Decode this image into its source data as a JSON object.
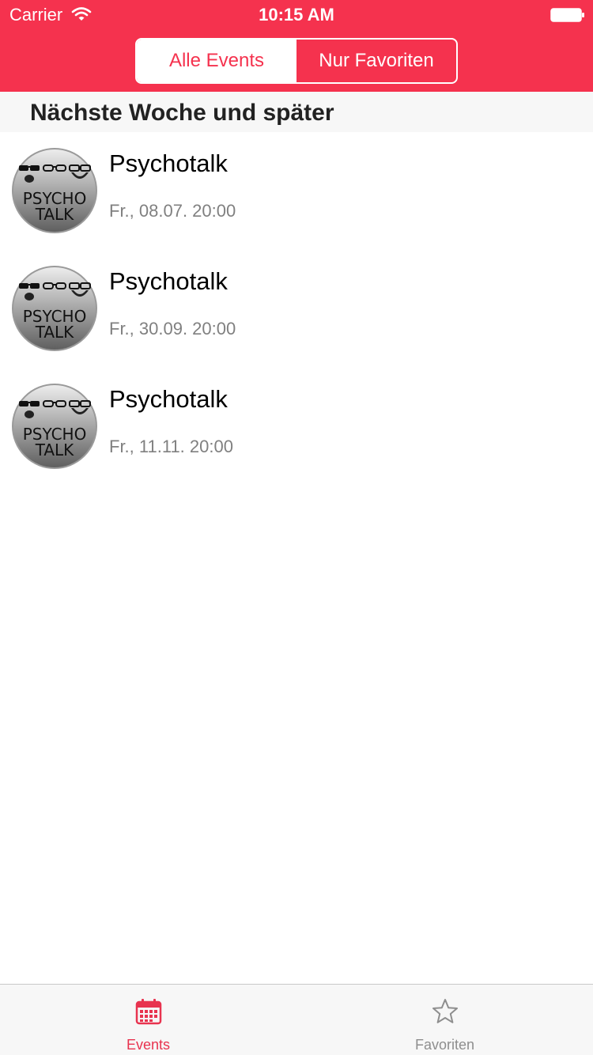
{
  "status_bar": {
    "carrier": "Carrier",
    "time": "10:15 AM",
    "wifi_icon": "wifi-icon",
    "battery_icon": "battery-icon"
  },
  "segmented_control": {
    "options": [
      "Alle Events",
      "Nur Favoriten"
    ],
    "selected": "Alle Events"
  },
  "section": {
    "title": "Nächste Woche und später"
  },
  "events": [
    {
      "title": "Psychotalk",
      "date": "Fr., 08.07. 20:00",
      "logo_text": [
        "PSYCHO",
        "TALK"
      ]
    },
    {
      "title": "Psychotalk",
      "date": "Fr., 30.09. 20:00",
      "logo_text": [
        "PSYCHO",
        "TALK"
      ]
    },
    {
      "title": "Psychotalk",
      "date": "Fr., 11.11. 20:00",
      "logo_text": [
        "PSYCHO",
        "TALK"
      ]
    }
  ],
  "tab_bar": {
    "tabs": [
      {
        "label": "Events",
        "icon": "calendar-icon",
        "active": true
      },
      {
        "label": "Favoriten",
        "icon": "star-icon",
        "active": false
      }
    ]
  },
  "colors": {
    "accent": "#f5324e",
    "active_tab": "#e8334f",
    "inactive_tab": "#8e8e8e",
    "section_bg": "#f7f7f7",
    "date_text": "#808080"
  }
}
